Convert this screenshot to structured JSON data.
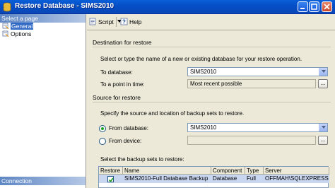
{
  "window": {
    "title": "Restore Database - SIMS2010",
    "minimize_icon": "minimize-icon",
    "maximize_icon": "maximize-icon",
    "close_icon": "close-icon"
  },
  "left_pane": {
    "select_page_header": "Select a page",
    "items": [
      {
        "label": "General",
        "icon": "page-icon",
        "selected": true
      },
      {
        "label": "Options",
        "icon": "page-icon",
        "selected": false
      }
    ],
    "connection_header": "Connection"
  },
  "toolbar": {
    "script_label": "Script",
    "help_label": "Help"
  },
  "destination": {
    "group_label": "Destination for restore",
    "instruction": "Select or type the name of a new or existing database for your restore operation.",
    "to_database_label": "To database:",
    "to_database_value": "SIMS2010",
    "point_in_time_label": "To a point in time:",
    "point_in_time_value": "Most recent possible",
    "ellipsis_label": "..."
  },
  "source": {
    "group_label": "Source for restore",
    "instruction": "Specify the source and location of backup sets to restore.",
    "from_database_label": "From database:",
    "from_database_value": "SIMS2010",
    "from_device_label": "From device:",
    "from_device_value": "",
    "ellipsis_label": "...",
    "selected_option": "From database"
  },
  "backup_sets": {
    "label": "Select the backup sets to restore:",
    "columns": [
      "Restore",
      "Name",
      "Component",
      "Type",
      "Server"
    ],
    "rows": [
      {
        "restore": true,
        "name": "SIMS2010-Full Database Backup",
        "component": "Database",
        "type": "Full",
        "server": "OFFMAH\\SQLEXPRESS"
      }
    ]
  },
  "colors": {
    "titlebar": "#0550c8",
    "selection": "#316ac5",
    "row_highlight": "#c9d6f0",
    "radio_dot": "#21a121"
  }
}
